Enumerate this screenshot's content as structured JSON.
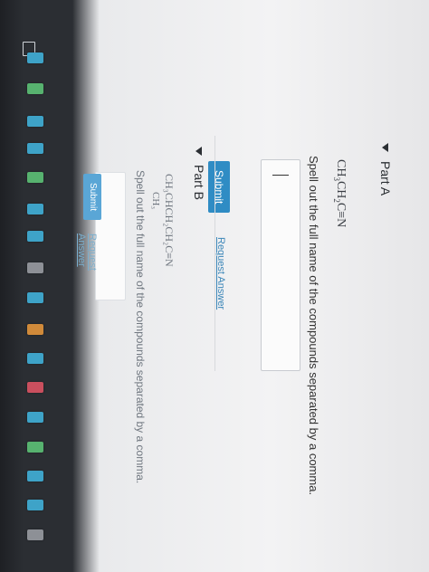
{
  "partA": {
    "header": "Part A",
    "formula_main": "CH",
    "formula_sub1": "3",
    "formula_mid": "CH",
    "formula_sub2": "2",
    "formula_end": "C≡N",
    "instruction": "Spell out the full name of the compounds separated by a comma.",
    "answer_value": "",
    "submit_label": "Submit",
    "request_label": "Request Answer"
  },
  "partB": {
    "header": "Part B",
    "formula_line1": "CH₃CHCH₂CH₂C≡N",
    "formula_line2": "CH₃",
    "instruction": "Spell out the full name of the compounds separated by a comma.",
    "answer_value": "",
    "submit_label": "Submit",
    "request_label": "Request Answer"
  },
  "desktop": {
    "icons": [
      "app-icon",
      "app-icon",
      "app-icon",
      "app-icon",
      "app-icon",
      "app-icon",
      "app-icon",
      "app-icon",
      "app-icon",
      "app-icon",
      "app-icon",
      "app-icon",
      "app-icon",
      "app-icon",
      "app-icon",
      "app-icon",
      "app-icon",
      "app-icon"
    ],
    "accent": "#2f8cc4"
  }
}
